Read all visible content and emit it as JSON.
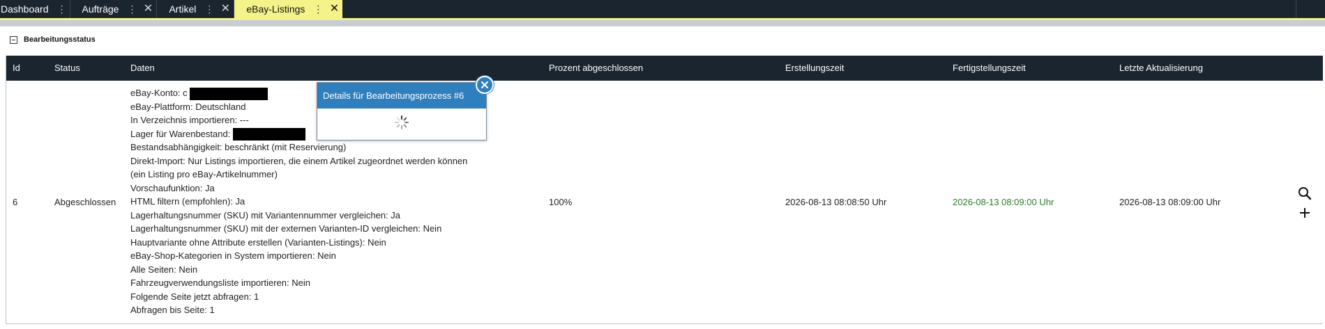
{
  "tabs": [
    {
      "label": "Dashboard",
      "closable": false,
      "active": false
    },
    {
      "label": "Aufträge",
      "closable": true,
      "active": false
    },
    {
      "label": "Artikel",
      "closable": true,
      "active": false
    },
    {
      "label": "eBay-Listings",
      "closable": true,
      "active": true
    }
  ],
  "section": {
    "title": "Bearbeitungsstatus"
  },
  "table": {
    "columns": [
      "Id",
      "Status",
      "Daten",
      "Prozent abgeschlossen",
      "Erstellungszeit",
      "Fertigstellungszeit",
      "Letzte Aktualisierung"
    ],
    "row": {
      "id": "6",
      "status": "Abgeschlossen",
      "details": [
        "eBay-Konto: c",
        "eBay-Plattform: Deutschland",
        "In Verzeichnis importieren: ---",
        "Lager für Warenbestand:",
        "Bestandsabhängigkeit: beschränkt (mit Reservierung)",
        "Direkt-Import: Nur Listings importieren, die einem Artikel zugeordnet werden können",
        "(ein Listing pro eBay-Artikelnummer)",
        "Vorschaufunktion: Ja",
        "HTML filtern (empfohlen): Ja",
        "Lagerhaltungsnummer (SKU) mit Variantennummer vergleichen: Ja",
        "Lagerhaltungsnummer (SKU) mit der externen Varianten-ID vergleichen: Nein",
        "Hauptvariante ohne Attribute erstellen (Varianten-Listings): Nein",
        "eBay-Shop-Kategorien in System importieren: Nein",
        "Alle Seiten: Nein",
        "Fahrzeugverwendungsliste importieren: Nein",
        "Folgende Seite jetzt abfragen: 1",
        "Abfragen bis Seite: 1"
      ],
      "percent": "100%",
      "created": "2026-08-13 08:08:50 Uhr",
      "finished": "2026-08-13 08:09:00 Uhr",
      "updated": "2026-08-13 08:09:00 Uhr",
      "finished_color": "#2d7a2d"
    }
  },
  "modal": {
    "title": "Details für Bearbeitungsprozess #6"
  },
  "icons": {
    "search": "search-icon",
    "add": "plus-icon",
    "close": "close-icon",
    "menu": "kebab-menu-icon",
    "collapse": "collapse-minus-icon",
    "loading": "loading-spinner-icon"
  },
  "colors": {
    "tabbar": "#1b2530",
    "active_tab": "#f4f38a",
    "modal_header": "#2f7fbf"
  }
}
